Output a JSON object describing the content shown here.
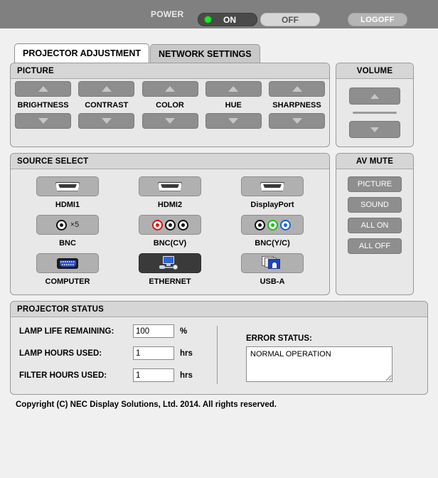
{
  "topbar": {
    "power_label": "POWER",
    "on_label": "ON",
    "off_label": "OFF",
    "logoff_label": "LOGOFF",
    "led_color": "#1ee81e",
    "on_active": true
  },
  "tabs": [
    {
      "label": "PROJECTOR ADJUSTMENT",
      "active": true
    },
    {
      "label": "NETWORK SETTINGS",
      "active": false
    }
  ],
  "picture": {
    "title": "PICTURE",
    "controls": [
      {
        "label": "BRIGHTNESS"
      },
      {
        "label": "CONTRAST"
      },
      {
        "label": "COLOR"
      },
      {
        "label": "HUE"
      },
      {
        "label": "SHARPNESS"
      }
    ]
  },
  "volume": {
    "title": "VOLUME",
    "up_icon": "triangle-up-icon",
    "down_icon": "triangle-down-icon"
  },
  "source_select": {
    "title": "SOURCE SELECT",
    "items": [
      {
        "label": "HDMI1",
        "icon": "hdmi-connector-icon",
        "selected": false
      },
      {
        "label": "HDMI2",
        "icon": "hdmi-connector-icon",
        "selected": false
      },
      {
        "label": "DisplayPort",
        "icon": "hdmi-connector-icon",
        "selected": false
      },
      {
        "label": "BNC",
        "icon": "bnc-single-x5-icon",
        "selected": false,
        "multiplier": "×5"
      },
      {
        "label": "BNC(CV)",
        "icon": "bnc-triple-rgb-icon",
        "selected": false,
        "ring_colors": [
          "#e01010",
          "#111111",
          "#111111"
        ]
      },
      {
        "label": "BNC(Y/C)",
        "icon": "bnc-triple-ygb-icon",
        "selected": false,
        "ring_colors": [
          "#111111",
          "#18c018",
          "#1560e0"
        ]
      },
      {
        "label": "COMPUTER",
        "icon": "vga-connector-icon",
        "selected": false
      },
      {
        "label": "ETHERNET",
        "icon": "ethernet-network-icon",
        "selected": true
      },
      {
        "label": "USB-A",
        "icon": "usb-images-icon",
        "selected": false
      }
    ]
  },
  "av_mute": {
    "title": "AV MUTE",
    "buttons": [
      {
        "label": "PICTURE"
      },
      {
        "label": "SOUND"
      },
      {
        "label": "ALL ON"
      },
      {
        "label": "ALL OFF"
      }
    ]
  },
  "projector_status": {
    "title": "PROJECTOR STATUS",
    "rows": [
      {
        "label": "LAMP LIFE REMAINING:",
        "value": "100",
        "unit": "%"
      },
      {
        "label": "LAMP HOURS USED:",
        "value": "1",
        "unit": "hrs"
      },
      {
        "label": "FILTER HOURS USED:",
        "value": "1",
        "unit": "hrs"
      }
    ],
    "error_status_label": "ERROR STATUS:",
    "error_status_value": "NORMAL OPERATION"
  },
  "footer": {
    "copyright": "Copyright (C) NEC Display Solutions, Ltd. 2014. All rights reserved."
  }
}
